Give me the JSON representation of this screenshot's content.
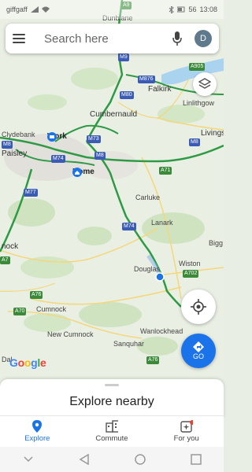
{
  "status_bar": {
    "carrier": "giffgaff",
    "time": "13:08",
    "battery": "56"
  },
  "search": {
    "placeholder": "Search here",
    "avatar_letter": "D"
  },
  "map": {
    "places": {
      "dunblane": "Dunblane",
      "falkirk": "Falkirk",
      "linlithgow": "Linlithgow",
      "cumbernauld": "Cumbernauld",
      "clydebank": "Clydebank",
      "paisley": "Paisley",
      "livingston": "Livings",
      "carluke": "Carluke",
      "lanark": "Lanark",
      "biggar": "Bigg",
      "wiston": "Wiston",
      "douglas": "Douglas",
      "kilmarnock": "nock",
      "cumnock": "Cumnock",
      "new_cumnock": "New Cumnock",
      "wanlockhead": "Wanlockhead",
      "sanquhar": "Sanquhar",
      "dalmellington": "Dal"
    },
    "pins": {
      "work": "Work",
      "home": "Home"
    },
    "roads": {
      "a9": "A9",
      "m9": "M9",
      "m876": "M876",
      "a905": "A905",
      "m80": "M80",
      "m73": "M73",
      "m8_west": "M8",
      "m8_mid": "M8",
      "m8_east": "M8",
      "m74_north": "M74",
      "m74_south": "M74",
      "m77": "M77",
      "a71": "A71",
      "a702": "A702",
      "a76_n": "A76",
      "a76_s": "A76",
      "a70": "A70",
      "a7": "A7"
    }
  },
  "buttons": {
    "go_label": "GO"
  },
  "logo": {
    "letters": [
      "G",
      "o",
      "o",
      "g",
      "l",
      "e"
    ],
    "colors": [
      "#4285F4",
      "#EA4335",
      "#FBBC05",
      "#4285F4",
      "#34A853",
      "#EA4335"
    ]
  },
  "sheet": {
    "title": "Explore nearby"
  },
  "nav": {
    "explore": "Explore",
    "commute": "Commute",
    "for_you": "For you"
  },
  "colors": {
    "accent": "#1a73e8",
    "motorway": "#2e9a45",
    "notification": "#ea4335"
  }
}
